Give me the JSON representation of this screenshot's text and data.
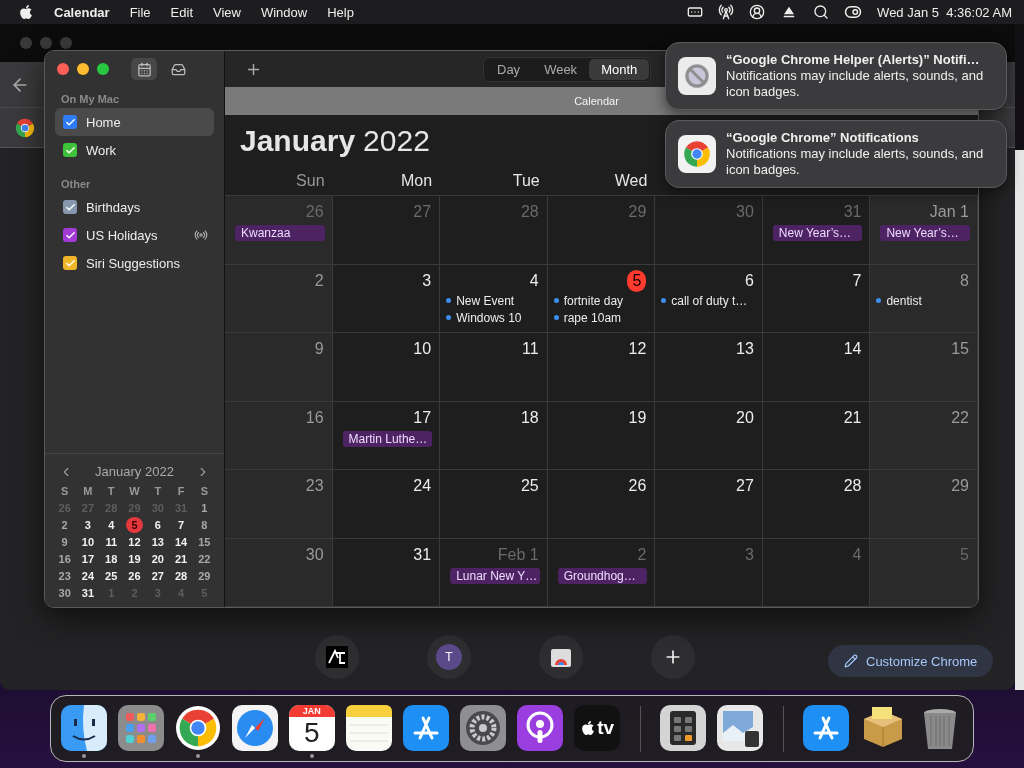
{
  "menubar": {
    "menus": [
      {
        "label": "Calendar",
        "bold": true
      },
      {
        "label": "File",
        "bold": false
      },
      {
        "label": "Edit",
        "bold": false
      },
      {
        "label": "View",
        "bold": false
      },
      {
        "label": "Window",
        "bold": false
      },
      {
        "label": "Help",
        "bold": false
      }
    ],
    "clock": "Wed Jan 5  4:36:02 AM"
  },
  "browser": {
    "shortcuts": [
      {
        "kind": "logo"
      },
      {
        "kind": "avatar",
        "letter": "T"
      },
      {
        "kind": "store"
      },
      {
        "kind": "add"
      }
    ],
    "customize_button": "Customize Chrome"
  },
  "calendar": {
    "sidebar": {
      "sections": [
        {
          "title": "On My Mac",
          "items": [
            {
              "label": "Home",
              "color": "#2f7cf6",
              "checked": true,
              "selected": true,
              "subscribed": false
            },
            {
              "label": "Work",
              "color": "#3fc23a",
              "checked": true,
              "selected": false,
              "subscribed": false
            }
          ]
        },
        {
          "title": "Other",
          "items": [
            {
              "label": "Birthdays",
              "color": "#8797ad",
              "checked": true,
              "selected": false,
              "subscribed": false
            },
            {
              "label": "US Holidays",
              "color": "#a43ad6",
              "checked": true,
              "selected": false,
              "subscribed": true
            },
            {
              "label": "Siri Suggestions",
              "color": "#f0b62a",
              "checked": true,
              "selected": false,
              "subscribed": false
            }
          ]
        }
      ]
    },
    "mini_calendar": {
      "title": "January 2022",
      "weekdays": [
        "S",
        "M",
        "T",
        "W",
        "T",
        "F",
        "S"
      ],
      "weeks": [
        [
          {
            "label": "26",
            "outside": true,
            "today": false
          },
          {
            "label": "27",
            "outside": true,
            "today": false
          },
          {
            "label": "28",
            "outside": true,
            "today": false
          },
          {
            "label": "29",
            "outside": true,
            "today": false
          },
          {
            "label": "30",
            "outside": true,
            "today": false
          },
          {
            "label": "31",
            "outside": true,
            "today": false
          },
          {
            "label": "1",
            "outside": false,
            "today": false
          }
        ],
        [
          {
            "label": "2",
            "outside": false,
            "today": false
          },
          {
            "label": "3",
            "outside": false,
            "today": false
          },
          {
            "label": "4",
            "outside": false,
            "today": false
          },
          {
            "label": "5",
            "outside": false,
            "today": true
          },
          {
            "label": "6",
            "outside": false,
            "today": false
          },
          {
            "label": "7",
            "outside": false,
            "today": false
          },
          {
            "label": "8",
            "outside": false,
            "today": false
          }
        ],
        [
          {
            "label": "9",
            "outside": false,
            "today": false
          },
          {
            "label": "10",
            "outside": false,
            "today": false
          },
          {
            "label": "11",
            "outside": false,
            "today": false
          },
          {
            "label": "12",
            "outside": false,
            "today": false
          },
          {
            "label": "13",
            "outside": false,
            "today": false
          },
          {
            "label": "14",
            "outside": false,
            "today": false
          },
          {
            "label": "15",
            "outside": false,
            "today": false
          }
        ],
        [
          {
            "label": "16",
            "outside": false,
            "today": false
          },
          {
            "label": "17",
            "outside": false,
            "today": false
          },
          {
            "label": "18",
            "outside": false,
            "today": false
          },
          {
            "label": "19",
            "outside": false,
            "today": false
          },
          {
            "label": "20",
            "outside": false,
            "today": false
          },
          {
            "label": "21",
            "outside": false,
            "today": false
          },
          {
            "label": "22",
            "outside": false,
            "today": false
          }
        ],
        [
          {
            "label": "23",
            "outside": false,
            "today": false
          },
          {
            "label": "24",
            "outside": false,
            "today": false
          },
          {
            "label": "25",
            "outside": false,
            "today": false
          },
          {
            "label": "26",
            "outside": false,
            "today": false
          },
          {
            "label": "27",
            "outside": false,
            "today": false
          },
          {
            "label": "28",
            "outside": false,
            "today": false
          },
          {
            "label": "29",
            "outside": false,
            "today": false
          }
        ],
        [
          {
            "label": "30",
            "outside": false,
            "today": false
          },
          {
            "label": "31",
            "outside": false,
            "today": false
          },
          {
            "label": "1",
            "outside": true,
            "today": false
          },
          {
            "label": "2",
            "outside": true,
            "today": false
          },
          {
            "label": "3",
            "outside": true,
            "today": false
          },
          {
            "label": "4",
            "outside": true,
            "today": false
          },
          {
            "label": "5",
            "outside": true,
            "today": false
          }
        ]
      ]
    },
    "views": [
      {
        "label": "Day",
        "selected": false
      },
      {
        "label": "Week",
        "selected": false
      },
      {
        "label": "Month",
        "selected": true
      }
    ],
    "tab_title": "Calendar",
    "month": "January",
    "year": "2022",
    "weekdays": [
      "Sun",
      "Mon",
      "Tue",
      "Wed"
    ],
    "weeks": [
      [
        {
          "label": "26",
          "outside": true,
          "today": false,
          "events": [
            {
              "title": "Kwanzaa",
              "kind": "allday",
              "color": "#4e2364"
            }
          ]
        },
        {
          "label": "27",
          "outside": true,
          "today": false
        },
        {
          "label": "28",
          "outside": true,
          "today": false
        },
        {
          "label": "29",
          "outside": true,
          "today": false
        },
        {
          "label": "30",
          "outside": true,
          "today": false
        },
        {
          "label": "31",
          "outside": true,
          "today": false,
          "events": [
            {
              "title": "New Year’s…",
              "kind": "allday",
              "color": "#4e2364"
            }
          ]
        },
        {
          "label": "Jan 1",
          "outside": false,
          "today": false,
          "events": [
            {
              "title": "New Year’s…",
              "kind": "allday",
              "color": "#4e2364"
            }
          ]
        }
      ],
      [
        {
          "label": "2",
          "outside": false,
          "today": false
        },
        {
          "label": "3",
          "outside": false,
          "today": false
        },
        {
          "label": "4",
          "outside": false,
          "today": false,
          "events": [
            {
              "title": "New Event",
              "kind": "timed",
              "color": "#3b8ff0"
            },
            {
              "title": "Windows 10",
              "kind": "timed",
              "color": "#3b8ff0"
            }
          ]
        },
        {
          "label": "5",
          "outside": false,
          "today": true,
          "events": [
            {
              "title": "fortnite day",
              "kind": "timed",
              "color": "#3b8ff0"
            },
            {
              "title": "rape 10am",
              "kind": "timed",
              "color": "#3b8ff0"
            }
          ]
        },
        {
          "label": "6",
          "outside": false,
          "today": false,
          "events": [
            {
              "title": "call of duty t…",
              "kind": "timed",
              "color": "#3b8ff0"
            }
          ]
        },
        {
          "label": "7",
          "outside": false,
          "today": false
        },
        {
          "label": "8",
          "outside": false,
          "today": false,
          "events": [
            {
              "title": "dentist",
              "kind": "timed",
              "color": "#3b8ff0"
            }
          ]
        }
      ],
      [
        {
          "label": "9",
          "outside": false,
          "today": false
        },
        {
          "label": "10",
          "outside": false,
          "today": false
        },
        {
          "label": "11",
          "outside": false,
          "today": false
        },
        {
          "label": "12",
          "outside": false,
          "today": false
        },
        {
          "label": "13",
          "outside": false,
          "today": false
        },
        {
          "label": "14",
          "outside": false,
          "today": false
        },
        {
          "label": "15",
          "outside": false,
          "today": false
        }
      ],
      [
        {
          "label": "16",
          "outside": false,
          "today": false
        },
        {
          "label": "17",
          "outside": false,
          "today": false,
          "events": [
            {
              "title": "Martin Luthe…",
              "kind": "allday",
              "color": "#4e2364"
            }
          ]
        },
        {
          "label": "18",
          "outside": false,
          "today": false
        },
        {
          "label": "19",
          "outside": false,
          "today": false
        },
        {
          "label": "20",
          "outside": false,
          "today": false
        },
        {
          "label": "21",
          "outside": false,
          "today": false
        },
        {
          "label": "22",
          "outside": false,
          "today": false
        }
      ],
      [
        {
          "label": "23",
          "outside": false,
          "today": false
        },
        {
          "label": "24",
          "outside": false,
          "today": false
        },
        {
          "label": "25",
          "outside": false,
          "today": false
        },
        {
          "label": "26",
          "outside": false,
          "today": false
        },
        {
          "label": "27",
          "outside": false,
          "today": false
        },
        {
          "label": "28",
          "outside": false,
          "today": false
        },
        {
          "label": "29",
          "outside": false,
          "today": false
        }
      ],
      [
        {
          "label": "30",
          "outside": false,
          "today": false
        },
        {
          "label": "31",
          "outside": false,
          "today": false
        },
        {
          "label": "Feb 1",
          "outside": true,
          "today": false,
          "events": [
            {
              "title": "Lunar New Y…",
              "kind": "allday",
              "color": "#4e2364"
            }
          ]
        },
        {
          "label": "2",
          "outside": true,
          "today": false,
          "events": [
            {
              "title": "Groundhog…",
              "kind": "allday",
              "color": "#4e2364"
            }
          ]
        },
        {
          "label": "3",
          "outside": true,
          "today": false
        },
        {
          "label": "4",
          "outside": true,
          "today": false
        },
        {
          "label": "5",
          "outside": true,
          "today": false
        }
      ]
    ]
  },
  "notifications": [
    {
      "kind": "helper",
      "title": "“Google Chrome Helper (Alerts)” Notifi…",
      "body": "Notifications may include alerts, sounds, and icon badges."
    },
    {
      "kind": "chrome",
      "title": "“Google Chrome” Notifications",
      "body": "Notifications may include alerts, sounds, and icon badges."
    }
  ],
  "dock": {
    "groups": [
      [
        {
          "kind": "finder",
          "running": true
        },
        {
          "kind": "launchpad",
          "running": false
        },
        {
          "kind": "chrome",
          "running": true
        },
        {
          "kind": "safari",
          "running": false
        },
        {
          "kind": "calendar",
          "running": true,
          "month": "JAN",
          "day": "5"
        },
        {
          "kind": "notes",
          "running": false
        },
        {
          "kind": "appstore",
          "running": false
        },
        {
          "kind": "settings",
          "running": false
        },
        {
          "kind": "podcasts",
          "running": false
        },
        {
          "kind": "tv",
          "running": false,
          "label": "tv"
        }
      ],
      [
        {
          "kind": "calculator",
          "running": false
        },
        {
          "kind": "preview",
          "running": false
        }
      ],
      [
        {
          "kind": "appstore",
          "running": false
        },
        {
          "kind": "package",
          "running": false
        },
        {
          "kind": "trash",
          "running": false
        }
      ]
    ]
  }
}
